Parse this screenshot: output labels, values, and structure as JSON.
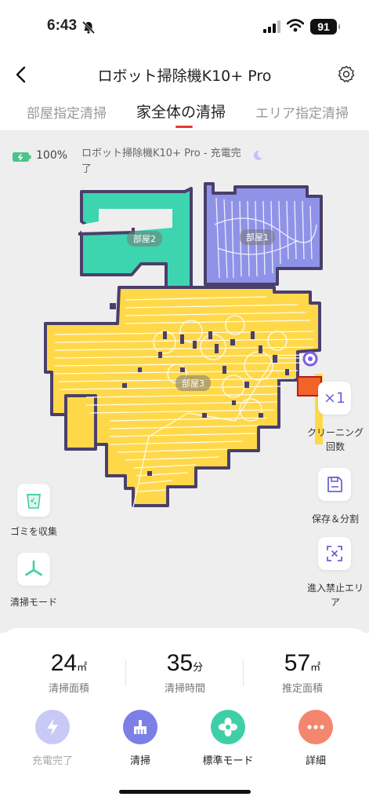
{
  "status_bar": {
    "time": "6:43",
    "battery_level": "91"
  },
  "header": {
    "title": "ロボット掃除機K10+ Pro"
  },
  "tabs": [
    {
      "label": "部屋指定清掃",
      "active": false
    },
    {
      "label": "家全体の清掃",
      "active": true
    },
    {
      "label": "エリア指定清掃",
      "active": false
    }
  ],
  "info": {
    "battery": "100%",
    "robot_status": "ロボット掃除機K10+ Pro - 充電完了"
  },
  "map": {
    "rooms": [
      {
        "label": "部屋2",
        "color": "#3dd4b0"
      },
      {
        "label": "部屋1",
        "color": "#8f93e8"
      },
      {
        "label": "部屋3",
        "color": "#ffd84a"
      }
    ],
    "wall_color": "#4a3f6b"
  },
  "side_left": [
    {
      "label": "ゴミを収集",
      "icon": "dustbin-icon"
    },
    {
      "label": "清掃モード",
      "icon": "fan-icon"
    }
  ],
  "side_right": [
    {
      "label": "クリーニング回数",
      "icon": "times-icon",
      "value": "×1"
    },
    {
      "label": "保存＆分割",
      "icon": "save-icon"
    },
    {
      "label": "進入禁止エリア",
      "icon": "no-go-zone-icon"
    }
  ],
  "stats": [
    {
      "value": "24",
      "unit": "㎡",
      "label": "清掃面積"
    },
    {
      "value": "35",
      "unit": "分",
      "label": "清掃時間"
    },
    {
      "value": "57",
      "unit": "㎡",
      "label": "推定面積"
    }
  ],
  "actions": [
    {
      "label": "充電完了",
      "icon": "lightning-icon",
      "color": "#c9c9f5",
      "disabled": true
    },
    {
      "label": "清掃",
      "icon": "brush-icon",
      "color": "#7b7fe6",
      "disabled": false
    },
    {
      "label": "標準モード",
      "icon": "fan-mode-icon",
      "color": "#3fcfa6",
      "disabled": false
    },
    {
      "label": "詳細",
      "icon": "more-icon",
      "color": "#f4866e",
      "disabled": false
    }
  ]
}
